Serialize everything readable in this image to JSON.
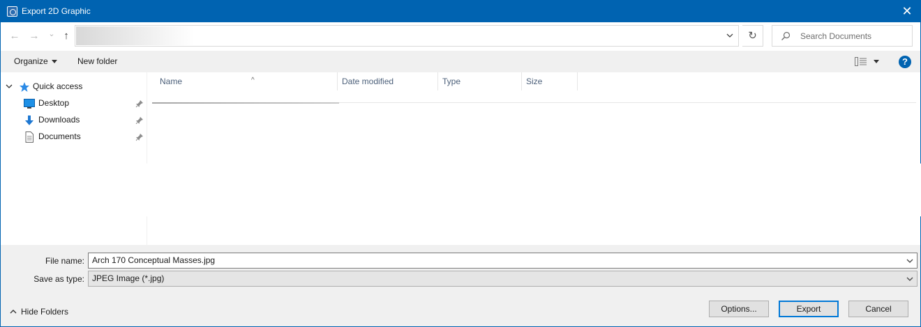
{
  "window": {
    "title": "Export 2D Graphic",
    "close_glyph": "✕"
  },
  "nav": {
    "back_glyph": "←",
    "forward_glyph": "→",
    "recent_glyph": "⌄",
    "up_glyph": "↑",
    "refresh_glyph": "↻"
  },
  "search": {
    "placeholder": "Search Documents"
  },
  "toolbar": {
    "organize_label": "Organize",
    "new_folder_label": "New folder",
    "help_glyph": "?"
  },
  "sidebar": {
    "quick_access": "Quick access",
    "items": [
      {
        "label": "Desktop",
        "icon": "desktop-icon"
      },
      {
        "label": "Downloads",
        "icon": "download-icon"
      },
      {
        "label": "Documents",
        "icon": "document-icon"
      }
    ]
  },
  "columns": [
    {
      "label": "Name"
    },
    {
      "label": "Date modified"
    },
    {
      "label": "Type"
    },
    {
      "label": "Size"
    }
  ],
  "sort_glyph": "^",
  "form": {
    "file_name_label": "File name:",
    "file_name_value": "Arch 170 Conceptual Masses.jpg",
    "save_type_label": "Save as type:",
    "save_type_value": "JPEG Image (*.jpg)"
  },
  "footer": {
    "hide_folders_label": "Hide Folders",
    "options_label": "Options...",
    "export_label": "Export",
    "cancel_label": "Cancel"
  },
  "colors": {
    "accent": "#0063b1",
    "panel": "#f0f0f0",
    "header_text": "#4c607a"
  }
}
